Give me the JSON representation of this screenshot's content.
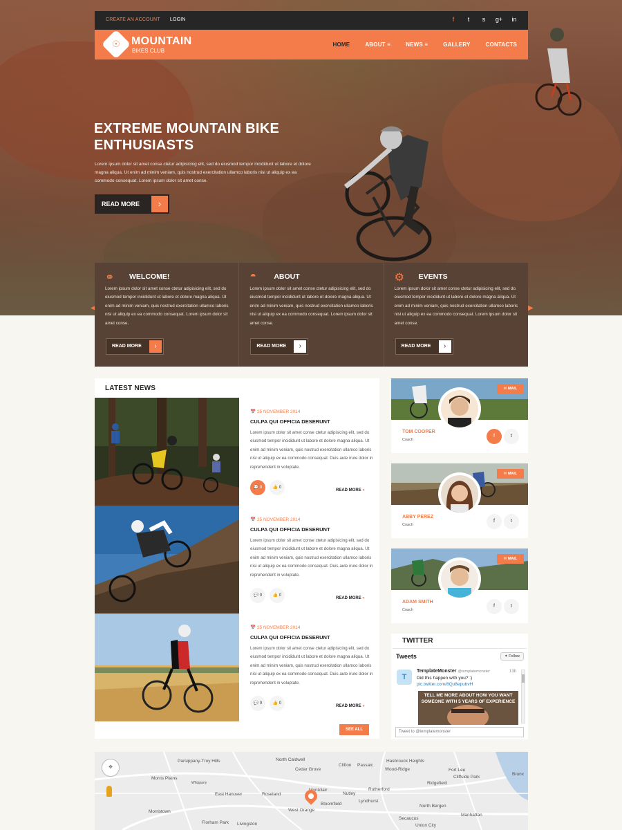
{
  "topbar": {
    "create_account": "CREATE AN ACCOUNT",
    "login": "LOGIN",
    "social": [
      "f",
      "t",
      "s",
      "g+",
      "in"
    ]
  },
  "brand": {
    "title": "MOUNTAIN",
    "subtitle": "BIKES CLUB"
  },
  "nav": [
    "HOME",
    "ABOUT",
    "NEWS",
    "GALLERY",
    "CONTACTS"
  ],
  "hero": {
    "title_line1": "EXTREME MOUNTAIN BIKE",
    "title_line2": "ENTHUSIASTS",
    "text": "Lorem ipsum dolor sit amet conse ctetur adipisicing elit, sed do eiusmod tempor incididunt ut labore et dolore magna aliqua. Ut enim ad minim veniam, quis nostrud exercitation ullamco laboris nisi ut aliquip ex ea commodo consequat. Lorem ipsum dolor sit amet conse.",
    "button": "READ MORE"
  },
  "features": [
    {
      "title": "WELCOME!",
      "text": "Lorem ipsum dolor sit amet conse ctetur adipisicing elit, sed do eiusmod tempor incididunt ut labore et dolore magna aliqua. Ut enim ad minim veniam, quis nostrud exercitation ullamco laboris nisi ut aliquip ex ea commodo consequat. Lorem ipsum dolor sit amet conse.",
      "button": "READ MORE"
    },
    {
      "title": "ABOUT",
      "text": "Lorem ipsum dolor sit amet conse ctetur adipisicing elit, sed do eiusmod tempor incididunt ut labore et dolore magna aliqua. Ut enim ad minim veniam, quis nostrud exercitation ullamco laboris nisi ut aliquip ex ea commodo consequat. Lorem ipsum dolor sit amet conse.",
      "button": "READ MORE"
    },
    {
      "title": "EVENTS",
      "text": "Lorem ipsum dolor sit amet conse ctetur adipisicing elit, sed do eiusmod tempor incididunt ut labore et dolore magna aliqua. Ut enim ad minim veniam, quis nostrud exercitation ullamco laboris nisi ut aliquip ex ea commodo consequat. Lorem ipsum dolor sit amet conse.",
      "button": "READ MORE"
    }
  ],
  "news": {
    "heading": "LATEST NEWS",
    "posts": [
      {
        "date": "25 NOVEMBER 2014",
        "title": "CULPA QUI OFFICIA DESERUNT",
        "body": "Lorem ipsum dolor sit amet conse ctetur adipisicing elit, sed do eiusmod tempor incididunt ut labore et dolore magna aliqua. Ut enim ad minim veniam, quis nostrud exercitation ullamco laboris nisi ut aliquip ex ea commodo consequat. Duis aute irure dolor in reprehenderit in voluptate.",
        "comments": "0",
        "likes": "0",
        "more": "READ MORE"
      },
      {
        "date": "25 NOVEMBER 2014",
        "title": "CULPA QUI OFFICIA DESERUNT",
        "body": "Lorem ipsum dolor sit amet conse ctetur adipisicing elit, sed do eiusmod tempor incididunt ut labore et dolore magna aliqua. Ut enim ad minim veniam, quis nostrud exercitation ullamco laboris nisi ut aliquip ex ea commodo consequat. Duis aute irure dolor in reprehenderit in voluptate.",
        "comments": "0",
        "likes": "0",
        "more": "READ MORE"
      },
      {
        "date": "25 NOVEMBER 2014",
        "title": "CULPA QUI OFFICIA DESERUNT",
        "body": "Lorem ipsum dolor sit amet conse ctetur adipisicing elit, sed do eiusmod tempor incididunt ut labore et dolore magna aliqua. Ut enim ad minim veniam, quis nostrud exercitation ullamco laboris nisi ut aliquip ex ea commodo consequat. Duis aute irure dolor in reprehenderit in voluptate.",
        "comments": "0",
        "likes": "0",
        "more": "READ MORE"
      }
    ],
    "see_all": "SEE ALL"
  },
  "coaches": [
    {
      "name": "TOM COOPER",
      "role": "Coach",
      "mail": "MAIL"
    },
    {
      "name": "ABBY PEREZ",
      "role": "Coach",
      "mail": "MAIL"
    },
    {
      "name": "ADAM SMITH",
      "role": "Coach",
      "mail": "MAIL"
    }
  ],
  "twitter": {
    "heading": "TWITTER",
    "tweets_label": "Tweets",
    "follow": "Follow",
    "user": "TemplateMonster",
    "handle": "@templatemonster",
    "time": "13h",
    "message": "Did this happen with you? :)",
    "link": "pic.twitter.com/8Qu8epubvH",
    "meme_line1": "TELL ME MORE ABOUT HOW YOU WANT",
    "meme_line2": "SOMEONE WITH 5 YEARS OF EXPERIENCE",
    "input_placeholder": "Tweet to @templatemonster"
  },
  "map": {
    "labels": [
      "Parsippany-Troy Hills",
      "North Caldwell",
      "Clifton",
      "Passaic",
      "Cedar Grove",
      "Rutherford",
      "Morris Plains",
      "Whippany",
      "East Hanover",
      "Roseland",
      "Montclair",
      "Nutley",
      "Lyndhurst",
      "Morristown",
      "West Orange",
      "Bloomfield",
      "Florham Park",
      "Livingston",
      "Union City",
      "North Bergen",
      "Secaucus",
      "Manhattan",
      "Wood-Ridge",
      "Ridgefield",
      "Cliffside Park",
      "Hasbrouck Heights",
      "Fort Lee",
      "Bronx"
    ]
  },
  "colors": {
    "accent": "#f47c4a",
    "dark": "#262626",
    "feature_band": "#574235"
  }
}
